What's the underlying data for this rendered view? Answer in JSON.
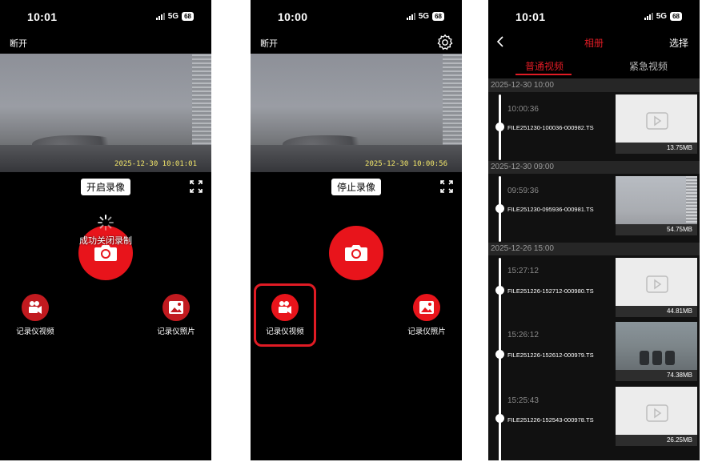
{
  "colors": {
    "accent": "#e01b24",
    "shutter": "#e8141b",
    "feature_icon": "#c11a1f",
    "timestamp": "#f2e66a"
  },
  "phone1": {
    "status": {
      "time": "10:01",
      "network": "5G",
      "battery": "68"
    },
    "topbar": {
      "disconnect": "断开",
      "settings_icon": "gear-icon"
    },
    "video": {
      "timestamp": "2025-12-30 10:01:01"
    },
    "record_button": "开启录像",
    "toast": "成功关闭录制",
    "features": [
      {
        "label": "记录仪视频",
        "icon": "video-camera-icon"
      },
      {
        "label": "记录仪照片",
        "icon": "image-icon"
      }
    ]
  },
  "phone2": {
    "status": {
      "time": "10:00",
      "network": "5G",
      "battery": "68"
    },
    "topbar": {
      "disconnect": "断开",
      "settings_icon": "gear-icon"
    },
    "video": {
      "timestamp": "2025-12-30 10:00:56"
    },
    "record_button": "停止录像",
    "features": [
      {
        "label": "记录仪视频",
        "icon": "video-camera-icon"
      },
      {
        "label": "记录仪照片",
        "icon": "image-icon"
      }
    ]
  },
  "phone3": {
    "status": {
      "time": "10:01",
      "network": "5G",
      "battery": "68"
    },
    "header": {
      "title": "相册",
      "select": "选择"
    },
    "tabs": [
      {
        "label": "普通视频"
      },
      {
        "label": "紧急视频"
      }
    ],
    "groups": [
      {
        "date": "2025-12-30 10:00",
        "items": [
          {
            "time": "10:00:36",
            "name": "FILE251230-100036-000982.TS",
            "size": "13.75MB",
            "thumb": "placeholder"
          }
        ]
      },
      {
        "date": "2025-12-30 09:00",
        "items": [
          {
            "time": "09:59:36",
            "name": "FILE251230-095936-000981.TS",
            "size": "54.75MB",
            "thumb": "photo1"
          }
        ]
      },
      {
        "date": "2025-12-26 15:00",
        "items": [
          {
            "time": "15:27:12",
            "name": "FILE251226-152712-000980.TS",
            "size": "44.81MB",
            "thumb": "placeholder"
          },
          {
            "time": "15:26:12",
            "name": "FILE251226-152612-000979.TS",
            "size": "74.38MB",
            "thumb": "photo2"
          },
          {
            "time": "15:25:43",
            "name": "FILE251226-152543-000978.TS",
            "size": "26.25MB",
            "thumb": "placeholder"
          }
        ]
      }
    ]
  }
}
